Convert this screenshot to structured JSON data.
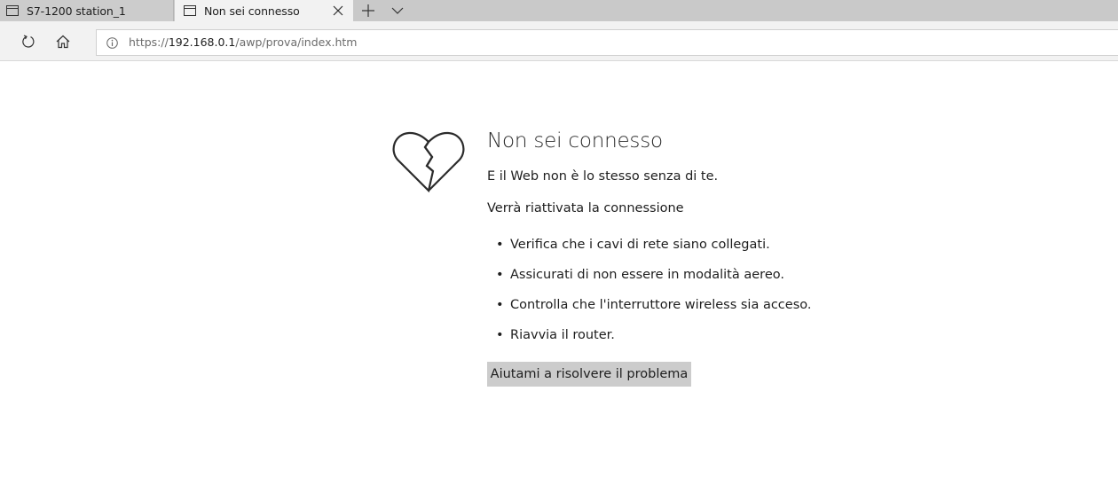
{
  "browser": {
    "tabs": [
      {
        "title": "S7-1200 station_1",
        "icon": "page-icon",
        "active": false
      },
      {
        "title": "Non sei connesso",
        "icon": "page-icon",
        "active": true
      }
    ],
    "close_icon": "close-icon",
    "new_tab_icon": "plus-icon",
    "tab_list_icon": "chevron-down-icon"
  },
  "navbar": {
    "refresh_icon": "refresh-icon",
    "home_icon": "home-icon",
    "site_info_icon": "info-icon",
    "url": {
      "scheme": "https://",
      "host": "192.168.0.1",
      "path": "/awp/prova/index.htm"
    }
  },
  "error_page": {
    "icon": "broken-heart-icon",
    "title": "Non sei connesso",
    "subtitle": "E il Web non è lo stesso senza di te.",
    "status": "Verrà riattivata la connessione",
    "suggestions": [
      "Verifica che i cavi di rete siano collegati.",
      "Assicurati di non essere in modalità aereo.",
      "Controlla che l'interruttore wireless sia acceso.",
      "Riavvia il router."
    ],
    "bullet": "•",
    "help_button": "Aiutami a risolvere il problema"
  },
  "colors": {
    "tabstrip": "#c9c9c9",
    "active_tab": "#f2f2f2",
    "help_button": "#cccccc",
    "text": "#1e1e1e"
  }
}
